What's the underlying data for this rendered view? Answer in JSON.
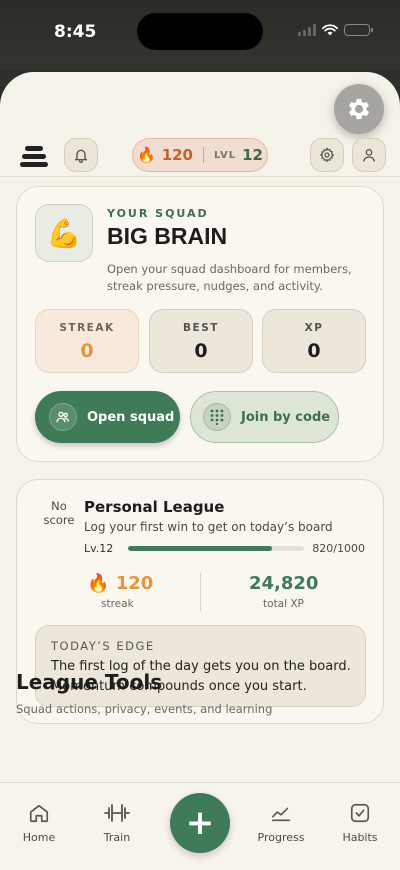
{
  "status": {
    "time": "8:45"
  },
  "header": {
    "streak": "120",
    "level_label": "LVL",
    "level": "12"
  },
  "squad": {
    "eyebrow": "YOUR SQUAD",
    "name": "BIG BRAIN",
    "emoji": "💪",
    "description": "Open your squad dashboard for members, streak pressure, nudges, and activity.",
    "stats": [
      {
        "label": "STREAK",
        "value": "0"
      },
      {
        "label": "BEST",
        "value": "0"
      },
      {
        "label": "XP",
        "value": "0"
      }
    ],
    "open_label": "Open squad",
    "join_label": "Join by code"
  },
  "league": {
    "no_score": "No score",
    "title": "Personal League",
    "subtitle": "Log your first win to get on today’s board",
    "level_label": "Lv.12",
    "xp_progress": "820/1000",
    "progress_fraction": 0.82,
    "streak": "120",
    "streak_label": "streak",
    "total_xp": "24,820",
    "total_xp_label": "total XP",
    "edge_title": "TODAY’S EDGE",
    "edge_text": "The first log of the day gets you on the board. Momentum compounds once you start."
  },
  "tools": {
    "title": "League Tools",
    "subtitle": "Squad actions, privacy, events, and learning"
  },
  "nav": {
    "home": "Home",
    "train": "Train",
    "add": "+",
    "progress": "Progress",
    "habits": "Habits"
  },
  "colors": {
    "accent_green": "#3f7a59",
    "streak_orange": "#e7943e",
    "background": "#f5f2e9"
  }
}
